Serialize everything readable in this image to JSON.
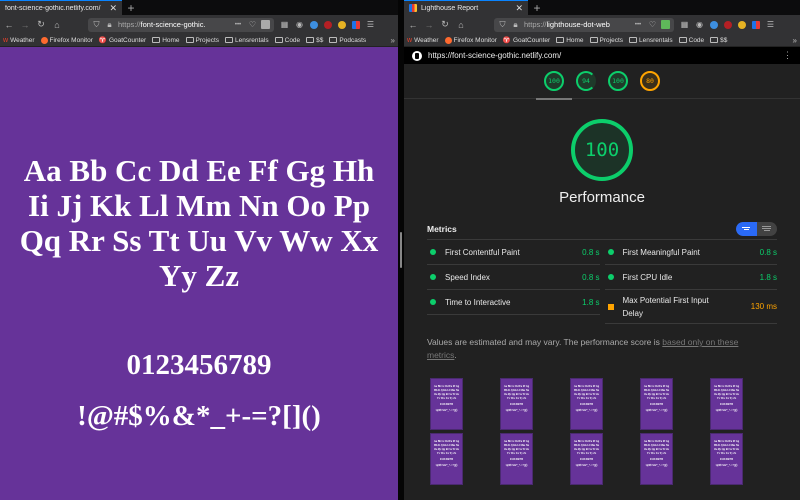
{
  "left_window": {
    "tab": {
      "title": "font-science-gothic.netlify.com/",
      "close": "✕"
    },
    "new_tab": "+",
    "nav": {
      "back": "←",
      "forward": "→",
      "reload": "↻",
      "home": "⌂"
    },
    "url": {
      "protocol": "https://",
      "host": "font-science-gothic.",
      "more": "•••"
    },
    "bookmarks": [
      "Weather",
      "Firefox Monitor",
      "GoatCounter",
      "Home",
      "Projects",
      "Lensrentals",
      "Code",
      "$$",
      "Podcasts"
    ],
    "bookmarks_more": "»",
    "page": {
      "alphabet": "Aa Bb Cc Dd Ee Ff Gg Hh Ii Jj Kk Ll Mm Nn Oo Pp Qq Rr Ss Tt Uu Vv Ww Xx Yy Zz",
      "digits": "0123456789",
      "symbols": "!@#$%&*_+-=?[]()",
      "background_color": "#663399"
    }
  },
  "right_window": {
    "tab": {
      "title": "Lighthouse Report",
      "close": "✕"
    },
    "new_tab": "+",
    "nav": {
      "back": "←",
      "forward": "→",
      "reload": "↻",
      "home": "⌂"
    },
    "url": {
      "protocol": "https://",
      "host": "lighthouse-dot-web",
      "more": "•••"
    },
    "bookmarks": [
      "Weather",
      "Firefox Monitor",
      "GoatCounter",
      "Home",
      "Projects",
      "Lensrentals",
      "Code",
      "$$"
    ],
    "bookmarks_more": "»",
    "report": {
      "url": "https://font-science-gothic.netlify.com/",
      "menu": "⋮",
      "category_scores": [
        {
          "name": "performance",
          "score": "100",
          "rating": "pass"
        },
        {
          "name": "accessibility",
          "score": "94",
          "rating": "pass"
        },
        {
          "name": "best-practices",
          "score": "100",
          "rating": "pass"
        },
        {
          "name": "seo",
          "score": "80",
          "rating": "average"
        }
      ],
      "performance": {
        "score": "100",
        "title": "Performance"
      },
      "metrics_title": "Metrics",
      "metrics": [
        {
          "label": "First Contentful Paint",
          "value": "0.8 s",
          "rating": "pass"
        },
        {
          "label": "First Meaningful Paint",
          "value": "0.8 s",
          "rating": "pass"
        },
        {
          "label": "Speed Index",
          "value": "0.8 s",
          "rating": "pass"
        },
        {
          "label": "First CPU Idle",
          "value": "1.8 s",
          "rating": "pass"
        },
        {
          "label": "Time to Interactive",
          "value": "1.8 s",
          "rating": "pass"
        },
        {
          "label": "Max Potential First Input Delay",
          "value": "130 ms",
          "rating": "average"
        }
      ],
      "note_text": "Values are estimated and may vary. The performance score is ",
      "note_link": "based only on these metrics",
      "note_end": ".",
      "filmstrip_frames": 10,
      "frame_alpha": "Aa Bb Cc Dd Ee Ff Gg Hh Ii Jj Kk Ll Mm Nn Oo Pp Qq Rr Ss Tt Uu Vv Ww Xx Yy Zz",
      "frame_digits": "0123456789",
      "frame_symbols": "!@#$%&*_+-=?[]()"
    }
  },
  "colors": {
    "pass": "#0cce6b",
    "average": "#ffa400",
    "accent": "#2a6af6",
    "purple": "#663399"
  }
}
